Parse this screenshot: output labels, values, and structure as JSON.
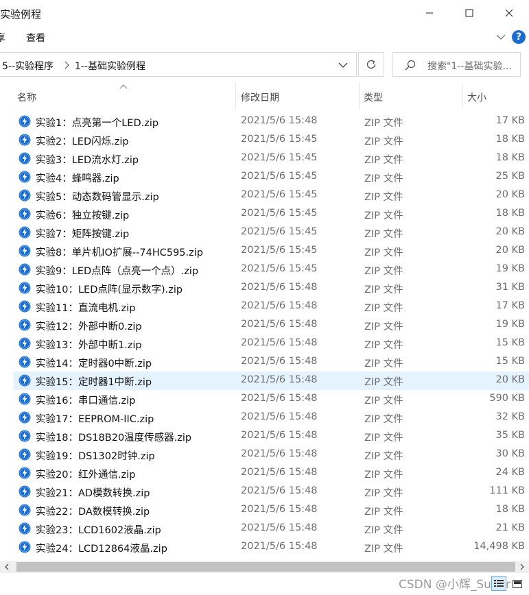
{
  "window": {
    "title": "实验例程"
  },
  "ribbon": {
    "tabs": [
      "享",
      "查看"
    ],
    "help": "?"
  },
  "address": {
    "crumbs": [
      "5--实验程序",
      "1--基础实验例程"
    ]
  },
  "search": {
    "placeholder": "搜索\"1--基础实验..."
  },
  "columns": {
    "name": "名称",
    "date": "修改日期",
    "type": "类型",
    "size": "大小"
  },
  "colors": {
    "highlight": "#e5f3ff",
    "icon_blue": "#1a6ccf"
  },
  "files": [
    {
      "name": "实验1：点亮第一个LED.zip",
      "date": "2021/5/6 15:48",
      "type": "ZIP 文件",
      "size": "17 KB"
    },
    {
      "name": "实验2：LED闪烁.zip",
      "date": "2021/5/6 15:45",
      "type": "ZIP 文件",
      "size": "18 KB"
    },
    {
      "name": "实验3：LED流水灯.zip",
      "date": "2021/5/6 15:45",
      "type": "ZIP 文件",
      "size": "18 KB"
    },
    {
      "name": "实验4：蜂鸣器.zip",
      "date": "2021/5/6 15:45",
      "type": "ZIP 文件",
      "size": "25 KB"
    },
    {
      "name": "实验5：动态数码管显示.zip",
      "date": "2021/5/6 15:45",
      "type": "ZIP 文件",
      "size": "20 KB"
    },
    {
      "name": "实验6：独立按键.zip",
      "date": "2021/5/6 15:45",
      "type": "ZIP 文件",
      "size": "18 KB"
    },
    {
      "name": "实验7：矩阵按键.zip",
      "date": "2021/5/6 15:45",
      "type": "ZIP 文件",
      "size": "20 KB"
    },
    {
      "name": "实验8：单片机IO扩展--74HC595.zip",
      "date": "2021/5/6 15:45",
      "type": "ZIP 文件",
      "size": "20 KB"
    },
    {
      "name": "实验9：LED点阵（点亮一个点）.zip",
      "date": "2021/5/6 15:45",
      "type": "ZIP 文件",
      "size": "19 KB"
    },
    {
      "name": "实验10：LED点阵(显示数字).zip",
      "date": "2021/5/6 15:48",
      "type": "ZIP 文件",
      "size": "31 KB"
    },
    {
      "name": "实验11：直流电机.zip",
      "date": "2021/5/6 15:48",
      "type": "ZIP 文件",
      "size": "17 KB"
    },
    {
      "name": "实验12：外部中断0.zip",
      "date": "2021/5/6 15:48",
      "type": "ZIP 文件",
      "size": "19 KB"
    },
    {
      "name": "实验13：外部中断1.zip",
      "date": "2021/5/6 15:48",
      "type": "ZIP 文件",
      "size": "15 KB"
    },
    {
      "name": "实验14：定时器0中断.zip",
      "date": "2021/5/6 15:48",
      "type": "ZIP 文件",
      "size": "15 KB"
    },
    {
      "name": "实验15：定时器1中断.zip",
      "date": "2021/5/6 15:48",
      "type": "ZIP 文件",
      "size": "20 KB",
      "highlighted": true
    },
    {
      "name": "实验16：串口通信.zip",
      "date": "2021/5/6 15:48",
      "type": "ZIP 文件",
      "size": "590 KB"
    },
    {
      "name": "实验17：EEPROM-IIC.zip",
      "date": "2021/5/6 15:48",
      "type": "ZIP 文件",
      "size": "32 KB"
    },
    {
      "name": "实验18：DS18B20温度传感器.zip",
      "date": "2021/5/6 15:48",
      "type": "ZIP 文件",
      "size": "35 KB"
    },
    {
      "name": "实验19：DS1302时钟.zip",
      "date": "2021/5/6 15:48",
      "type": "ZIP 文件",
      "size": "30 KB"
    },
    {
      "name": "实验20：红外通信.zip",
      "date": "2021/5/6 15:48",
      "type": "ZIP 文件",
      "size": "24 KB"
    },
    {
      "name": "实验21：AD模数转换.zip",
      "date": "2021/5/6 15:48",
      "type": "ZIP 文件",
      "size": "111 KB"
    },
    {
      "name": "实验22：DA数模转换.zip",
      "date": "2021/5/6 15:48",
      "type": "ZIP 文件",
      "size": "18 KB"
    },
    {
      "name": "实验23：LCD1602液晶.zip",
      "date": "2021/5/6 15:48",
      "type": "ZIP 文件",
      "size": "21 KB"
    },
    {
      "name": "实验24：LCD12864液晶.zip",
      "date": "2021/5/6 15:48",
      "type": "ZIP 文件",
      "size": "14,498 KB"
    }
  ],
  "watermark": "CSDN @小辉_Super"
}
